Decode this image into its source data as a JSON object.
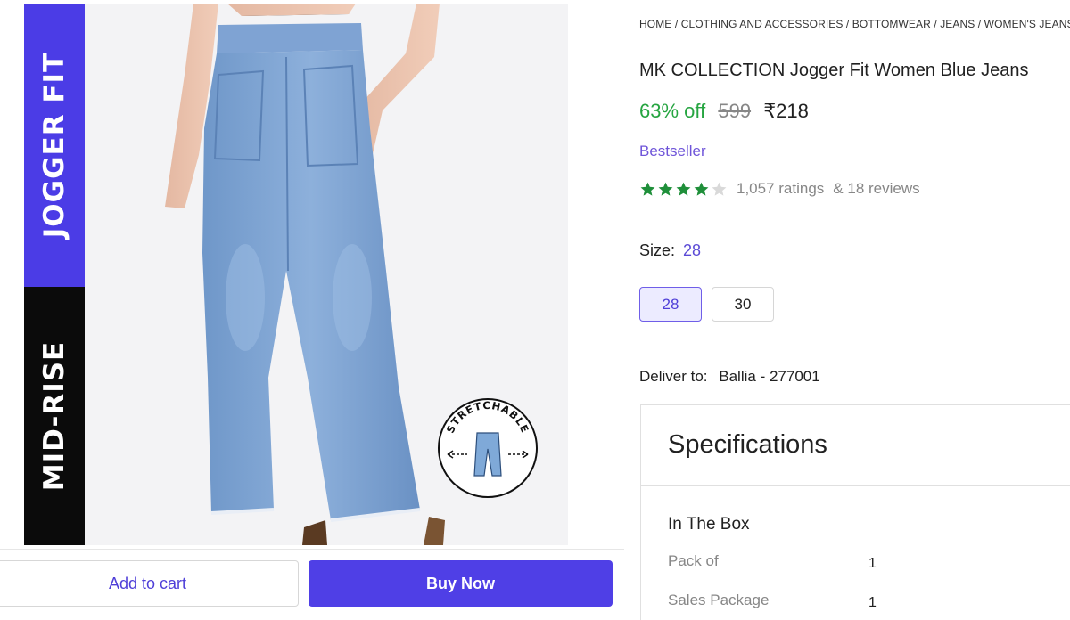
{
  "image": {
    "band_top_text": "JOGGER FIT",
    "band_bottom_text": "MID-RISE",
    "badge_text": "STRETCHABLE",
    "band_top_color": "#4b3ce6",
    "band_bottom_color": "#0b0b0b"
  },
  "actions": {
    "add_to_cart": "Add to cart",
    "buy_now": "Buy Now",
    "buy_color": "#4f3fe6"
  },
  "product": {
    "breadcrumb": "HOME / CLOTHING AND ACCESSORIES / BOTTOMWEAR / JEANS / WOMEN'S JEANS",
    "title": "MK COLLECTION Jogger Fit Women Blue Jeans",
    "discount": "63% off",
    "mrp": "599",
    "price": "₹218",
    "bestseller": "Bestseller",
    "rating_stars": 4,
    "rating_max": 5,
    "ratings_text": "1,057 ratings",
    "reviews_text": "& 18 reviews"
  },
  "size": {
    "label": "Size:",
    "selected": "28",
    "options": [
      "28",
      "30"
    ]
  },
  "delivery": {
    "label": "Deliver to:",
    "location": "Ballia - 277001"
  },
  "specs": {
    "title": "Specifications",
    "section": "In The Box",
    "rows": [
      {
        "key": "Pack of",
        "value": "1"
      },
      {
        "key": "Sales Package",
        "value": "1"
      }
    ]
  }
}
